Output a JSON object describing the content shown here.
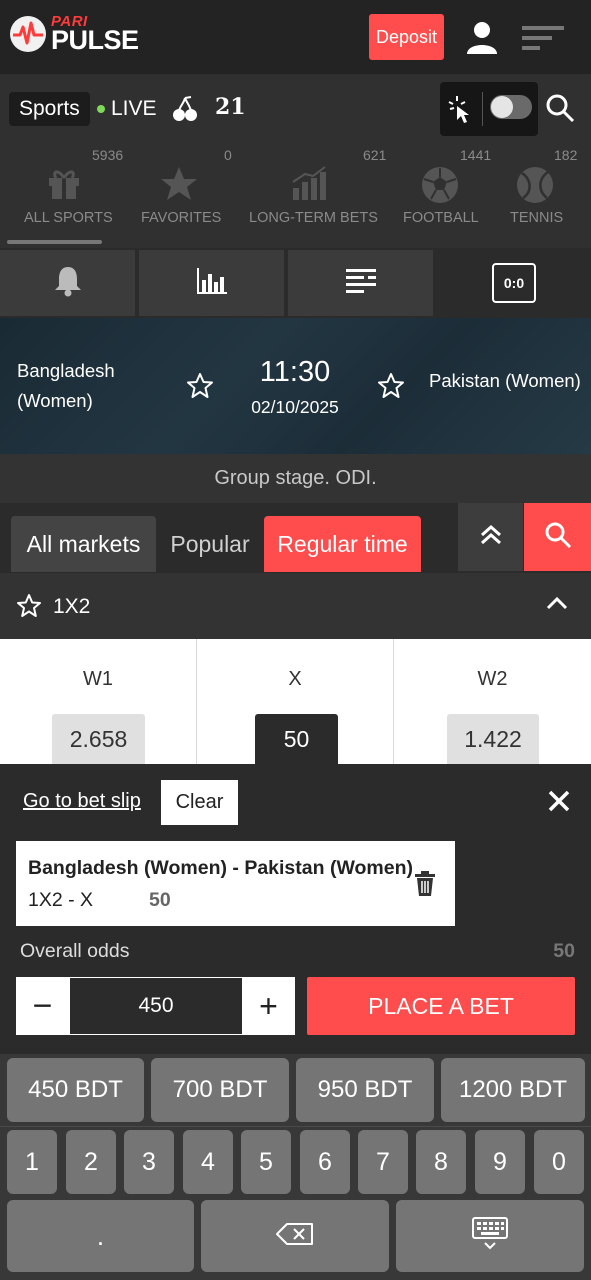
{
  "header": {
    "brand_small": "PARI",
    "brand_big": "PULSE",
    "deposit_label": "Deposit"
  },
  "sportsbar": {
    "sports_label": "Sports",
    "live_label": "LIVE",
    "twentyone_label": "21"
  },
  "categories": [
    {
      "label": "ALL SPORTS",
      "count": "5936",
      "icon": "gift-icon"
    },
    {
      "label": "FAVORITES",
      "count": "0",
      "icon": "star-icon"
    },
    {
      "label": "LONG-TERM BETS",
      "count": "621",
      "icon": "chart-icon"
    },
    {
      "label": "FOOTBALL",
      "count": "1441",
      "icon": "football-icon"
    },
    {
      "label": "TENNIS",
      "count": "182",
      "icon": "tennis-ball-icon"
    }
  ],
  "tools": {
    "score_label": "0:0"
  },
  "match": {
    "team1_line1": "Bangladesh",
    "team1_line2": "(Women)",
    "team2": "Pakistan (Women)",
    "time": "11:30",
    "date": "02/10/2025",
    "stage": "Group stage. ODI."
  },
  "market_tabs": {
    "all": "All markets",
    "popular": "Popular",
    "regular": "Regular time"
  },
  "market": {
    "title": "1X2",
    "outcomes": [
      {
        "label": "W1",
        "odd": "2.658"
      },
      {
        "label": "X",
        "odd": "50"
      },
      {
        "label": "W2",
        "odd": "1.422"
      }
    ]
  },
  "slip": {
    "goto_label": "Go to bet slip",
    "clear_label": "Clear",
    "match": "Bangladesh (Women) - Pakistan (Women)",
    "market": "1X2 - X",
    "odd": "50",
    "overall_label": "Overall odds",
    "overall_value": "50",
    "minus": "−",
    "stake": "450",
    "plus": "+",
    "place_label": "PLACE A BET"
  },
  "keyboard": {
    "quick": [
      "450 BDT",
      "700 BDT",
      "950 BDT",
      "1200 BDT"
    ],
    "digits": [
      "1",
      "2",
      "3",
      "4",
      "5",
      "6",
      "7",
      "8",
      "9",
      "0"
    ],
    "dot": "."
  },
  "colors": {
    "accent": "#ff4d4d",
    "live_dot": "#7ed957",
    "background": "#2b2b2b"
  }
}
